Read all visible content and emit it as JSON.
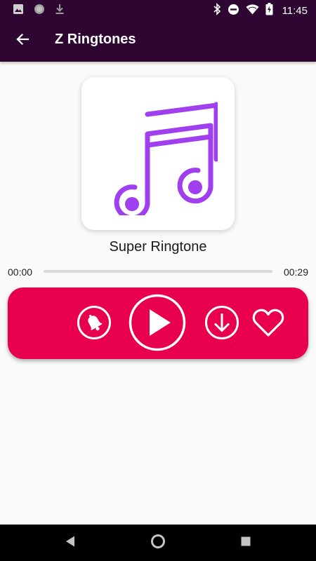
{
  "status_bar": {
    "time": "11:45",
    "left_icons": [
      "image-icon",
      "circle-icon",
      "download-icon"
    ],
    "right_icons": [
      "bluetooth-icon",
      "do-not-disturb-icon",
      "wifi-icon",
      "battery-icon"
    ]
  },
  "app_bar": {
    "title": "Z Ringtones",
    "back_icon": "arrow-back-icon"
  },
  "player": {
    "song_title": "Super Ringtone",
    "time_elapsed": "00:00",
    "time_total": "00:29",
    "progress": 0,
    "art_icon": "music-note-icon"
  },
  "controls": {
    "ringtone_icon": "bell-icon",
    "play_icon": "play-icon",
    "download_icon": "download-circle-icon",
    "favorite_icon": "heart-icon"
  },
  "nav_bar": {
    "icons": [
      "nav-back-icon",
      "nav-home-icon",
      "nav-recents-icon"
    ]
  },
  "colors": {
    "primary_dark": "#2d0731",
    "accent": "#e8004f",
    "note_purple": "#a03ff0",
    "background": "#fafafa"
  }
}
